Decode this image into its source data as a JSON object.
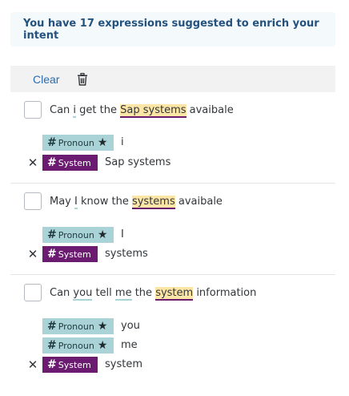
{
  "banner": {
    "text": "You have 17 expressions suggested to enrich your intent"
  },
  "toolbar": {
    "clear_label": "Clear",
    "delete_icon": "trash-icon"
  },
  "expressions": [
    {
      "parts": [
        "Can ",
        "i",
        " get the ",
        "Sap systems",
        " avaibale"
      ],
      "annotations": [
        {
          "tag": "Pronoun",
          "starred": true,
          "value": "i",
          "removable": false
        },
        {
          "tag": "System",
          "starred": false,
          "value": "Sap systems",
          "removable": true
        }
      ]
    },
    {
      "parts": [
        "May ",
        "I",
        " know the ",
        "systems",
        " avaibale"
      ],
      "annotations": [
        {
          "tag": "Pronoun",
          "starred": true,
          "value": "I",
          "removable": false
        },
        {
          "tag": "System",
          "starred": false,
          "value": "systems",
          "removable": true
        }
      ]
    },
    {
      "parts": [
        "Can ",
        "you",
        " tell ",
        "me",
        " the ",
        "system",
        " information"
      ],
      "annotations": [
        {
          "tag": "Pronoun",
          "starred": true,
          "value": "you",
          "removable": false
        },
        {
          "tag": "Pronoun",
          "starred": true,
          "value": "me",
          "removable": false
        },
        {
          "tag": "System",
          "starred": false,
          "value": "system",
          "removable": true
        }
      ]
    }
  ],
  "tag_symbols": {
    "hash": "#",
    "star": "★",
    "remove": "✕"
  },
  "colors": {
    "pronoun": "#a9d3d7",
    "system": "#6c1c70",
    "highlight": "#fde6a5",
    "title": "#24527f",
    "link": "#2b6cb0"
  }
}
